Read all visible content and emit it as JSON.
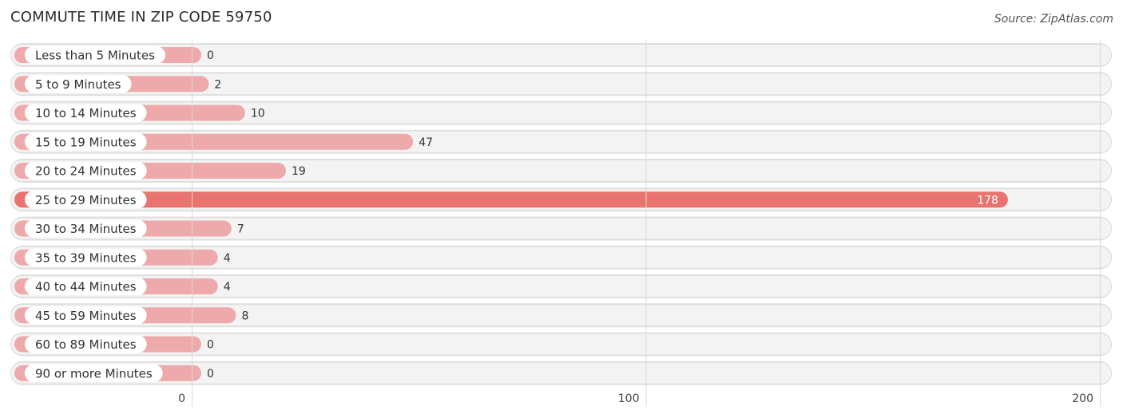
{
  "header": {
    "title": "COMMUTE TIME IN ZIP CODE 59750",
    "source": "Source: ZipAtlas.com"
  },
  "colors": {
    "bar": "#eeaaaa",
    "bar_highlight": "#e8736f",
    "row_background": "#f3f3f3"
  },
  "chart_data": {
    "type": "bar",
    "orientation": "horizontal",
    "title": "COMMUTE TIME IN ZIP CODE 59750",
    "xlabel": "",
    "ylabel": "",
    "categories": [
      "Less than 5 Minutes",
      "5 to 9 Minutes",
      "10 to 14 Minutes",
      "15 to 19 Minutes",
      "20 to 24 Minutes",
      "25 to 29 Minutes",
      "30 to 34 Minutes",
      "35 to 39 Minutes",
      "40 to 44 Minutes",
      "45 to 59 Minutes",
      "60 to 89 Minutes",
      "90 or more Minutes"
    ],
    "values": [
      0,
      2,
      10,
      47,
      19,
      178,
      7,
      4,
      4,
      8,
      0,
      0
    ],
    "highlight_index": 5,
    "xlim": [
      0,
      200
    ],
    "xticks": [
      0,
      100,
      200
    ],
    "xtick_labels": [
      "0",
      "100",
      "200"
    ],
    "grid": true
  }
}
